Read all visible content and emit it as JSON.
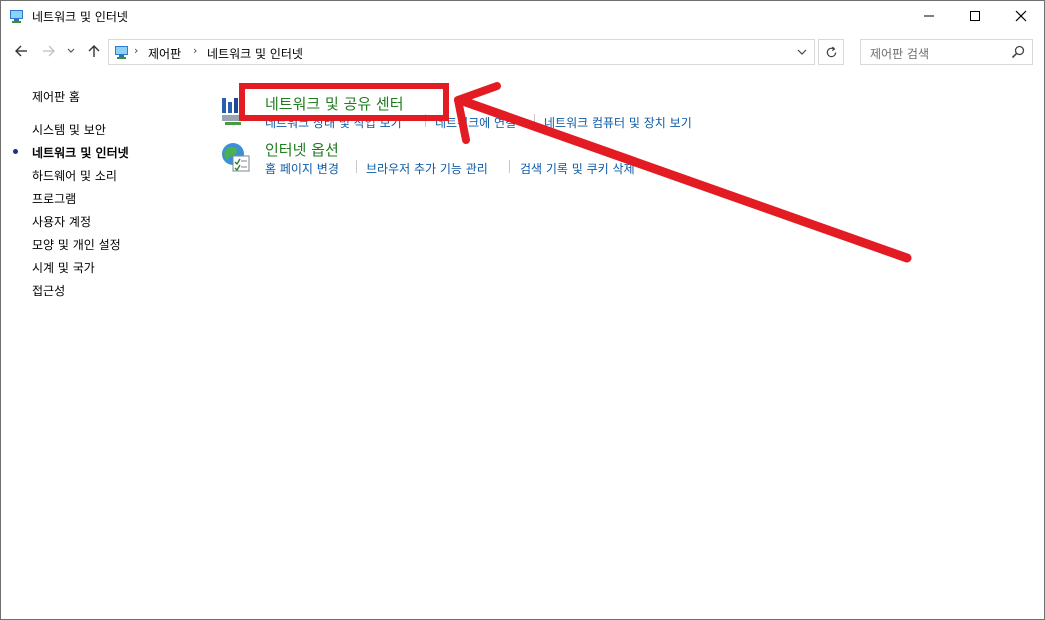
{
  "window": {
    "title": "네트워크 및 인터넷"
  },
  "breadcrumb": {
    "items": [
      "제어판",
      "네트워크 및 인터넷"
    ]
  },
  "search": {
    "placeholder": "제어판 검색"
  },
  "sidebar": {
    "items": [
      {
        "label": "제어판 홈"
      },
      {
        "label": "시스템 및 보안"
      },
      {
        "label": "네트워크 및 인터넷",
        "active": true
      },
      {
        "label": "하드웨어 및 소리"
      },
      {
        "label": "프로그램"
      },
      {
        "label": "사용자 계정"
      },
      {
        "label": "모양 및 개인 설정"
      },
      {
        "label": "시계 및 국가"
      },
      {
        "label": "접근성"
      }
    ]
  },
  "categories": [
    {
      "title": "네트워크 및 공유 센터",
      "links": [
        "네트워크 상태 및 작업 보기",
        "네트워크에 연결",
        "네트워크 컴퓨터 및 장치 보기"
      ]
    },
    {
      "title": "인터넷 옵션",
      "links": [
        "홈 페이지 변경",
        "브라우저 추가 기능 관리",
        "검색 기록 및 쿠키 삭제"
      ]
    }
  ],
  "colors": {
    "category_title": "#1e7d1e",
    "link": "#0d5aa8",
    "annotation": "#e31b23",
    "active_bullet": "#1e3287"
  }
}
